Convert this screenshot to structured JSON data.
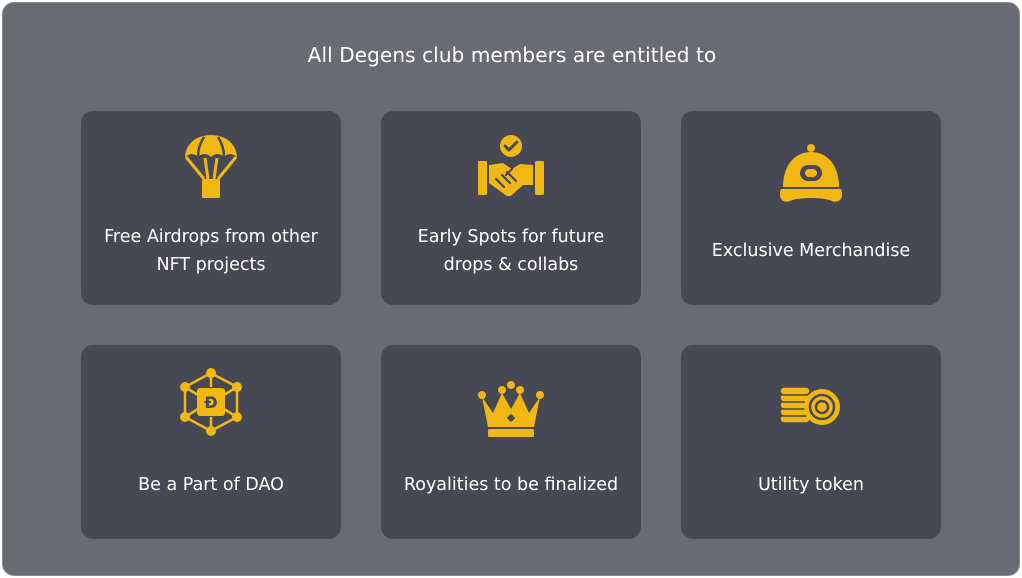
{
  "heading": "All Degens club members are entitled to",
  "accent_color": "#f1b814",
  "cards": [
    {
      "icon": "parachute-airdrop-icon",
      "label": "Free Airdrops from other NFT projects"
    },
    {
      "icon": "handshake-check-icon",
      "label": "Early Spots for future drops & collabs"
    },
    {
      "icon": "cap-icon",
      "label": "Exclusive Merchandise"
    },
    {
      "icon": "dao-network-icon",
      "label": "Be a Part of DAO"
    },
    {
      "icon": "crown-icon",
      "label": "Royalities to be finalized"
    },
    {
      "icon": "coins-token-icon",
      "label": "Utility token"
    }
  ]
}
